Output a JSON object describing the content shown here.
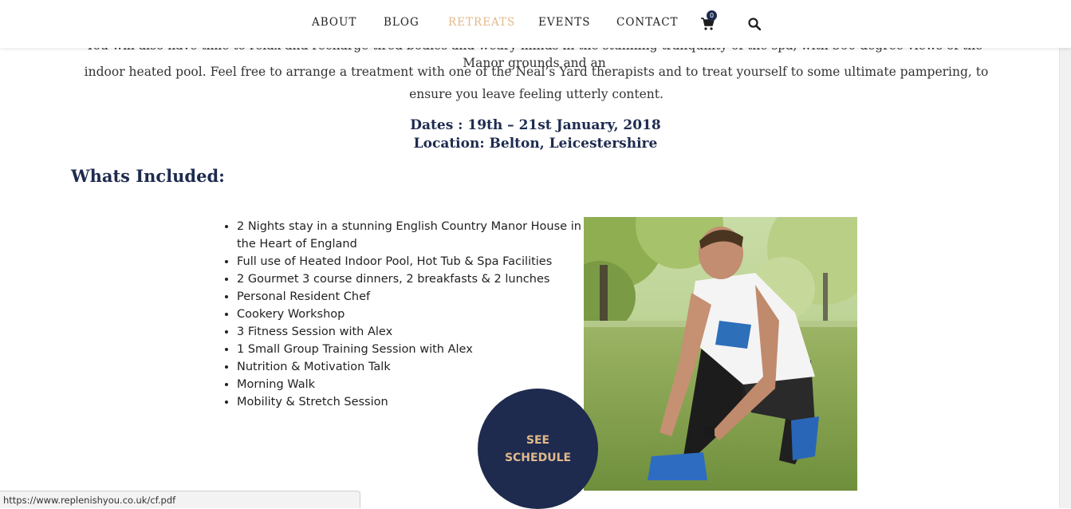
{
  "nav": {
    "items": [
      {
        "label": "ABOUT",
        "active": false
      },
      {
        "label": "BLOG",
        "active": false
      },
      {
        "label": "RETREATS",
        "active": true
      },
      {
        "label": "EVENTS",
        "active": false
      },
      {
        "label": "CONTACT",
        "active": false
      }
    ],
    "cart_count": "0",
    "cart_icon": "shopping-cart-icon",
    "search_icon": "magnifier-search-icon"
  },
  "intro": {
    "partial_line": "You will also have time to relax and recharge tired bodies and weary minds in the stunning tranquility of the spa, with 360 degree views of the Manor grounds and an",
    "text": "indoor heated pool. Feel free to arrange a treatment with one of the Neal’s Yard therapists and to treat yourself to some ultimate pampering, to ensure you leave feeling utterly content."
  },
  "event": {
    "dates": "Dates : 19th – 21st January, 2018",
    "location": "Location: Belton, Leicestershire"
  },
  "included": {
    "title": "Whats Included:",
    "items": [
      "2 Nights stay in a stunning English Country Manor House in the Heart of England",
      "Full use of Heated Indoor Pool, Hot Tub & Spa Facilities",
      "2 Gourmet 3 course dinners, 2 breakfasts & 2 lunches",
      "Personal Resident Chef",
      "Cookery Workshop",
      "3 Fitness Session with Alex",
      "1 Small Group Training Session with Alex",
      "Nutrition & Motivation Talk",
      "Morning Walk",
      "Mobility & Stretch Session"
    ]
  },
  "cta": {
    "line1": "SEE",
    "line2": "SCHEDULE"
  },
  "status_bar": {
    "url": "https://www.replenishyou.co.uk/cf.pdf"
  },
  "colors": {
    "navy": "#1e2b4f",
    "gold": "#e2b98a"
  }
}
